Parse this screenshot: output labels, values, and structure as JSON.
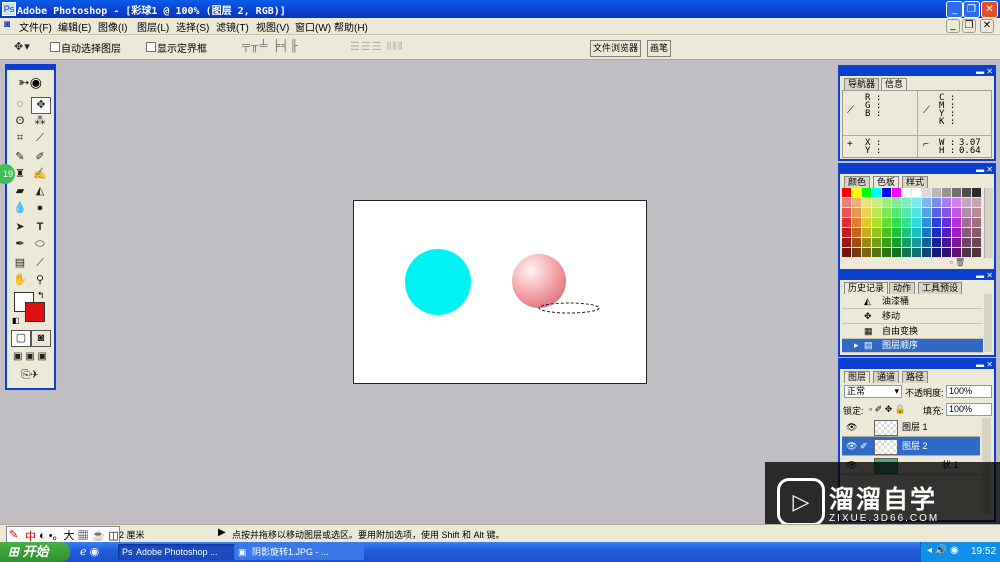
{
  "window": {
    "title": "Adobe Photoshop - [彩球1 @ 100% (图层 2, RGB)]"
  },
  "menu": [
    "文件(F)",
    "编辑(E)",
    "图像(I)",
    "图层(L)",
    "选择(S)",
    "滤镜(T)",
    "视图(V)",
    "窗口(W)",
    "帮助(H)"
  ],
  "options": {
    "auto_select": "自动选择图层",
    "show_bounds": "显示定界框",
    "file_browser": "文件浏览器",
    "brushes": "画笔"
  },
  "toolbox": {
    "badge": "19"
  },
  "info_panel": {
    "tabs": [
      "导航器",
      "信息"
    ],
    "rgb": "R :\nG :\nB :",
    "cmyk": "C :\nM :\nY :\nK :",
    "xy": "X :\nY :",
    "wh": "W :\nH :",
    "w_value": "3.07",
    "h_value": "0.64"
  },
  "swatches_panel": {
    "tabs": [
      "颜色",
      "色板",
      "样式"
    ]
  },
  "history_panel": {
    "tabs": [
      "历史记录",
      "动作",
      "工具预设"
    ],
    "items": [
      "油漆桶",
      "移动",
      "自由变换",
      "图层顺序"
    ]
  },
  "layers_panel": {
    "tabs": [
      "图层",
      "通道",
      "路径"
    ],
    "blend_mode": "正常",
    "opacity_label": "不透明度:",
    "opacity": "100%",
    "lock_label": "锁定:",
    "fill_label": "填充:",
    "fill": "100%",
    "layers": [
      "图层 1",
      "图层 2",
      "状 1"
    ]
  },
  "statusbar": {
    "size": "2 厘米",
    "hint": "点按并拖移以移动图层或选区。要用附加选项，使用 Shift 和 Alt 键。",
    "ime": "中"
  },
  "taskbar": {
    "start": "开始",
    "tasks": [
      "Adobe Photoshop ...",
      "阴影旋转1.JPG - ..."
    ],
    "clock": "19:52"
  },
  "watermark": {
    "name": "溜溜自学",
    "url": "ZIXUE.3D66.COM"
  },
  "colors": {
    "accent": "#0a3fd0",
    "cyan_circle": "#00f3f3",
    "pink_sphere": "#f4a6ac",
    "foreground": "#ffffff",
    "background": "#e01010"
  }
}
